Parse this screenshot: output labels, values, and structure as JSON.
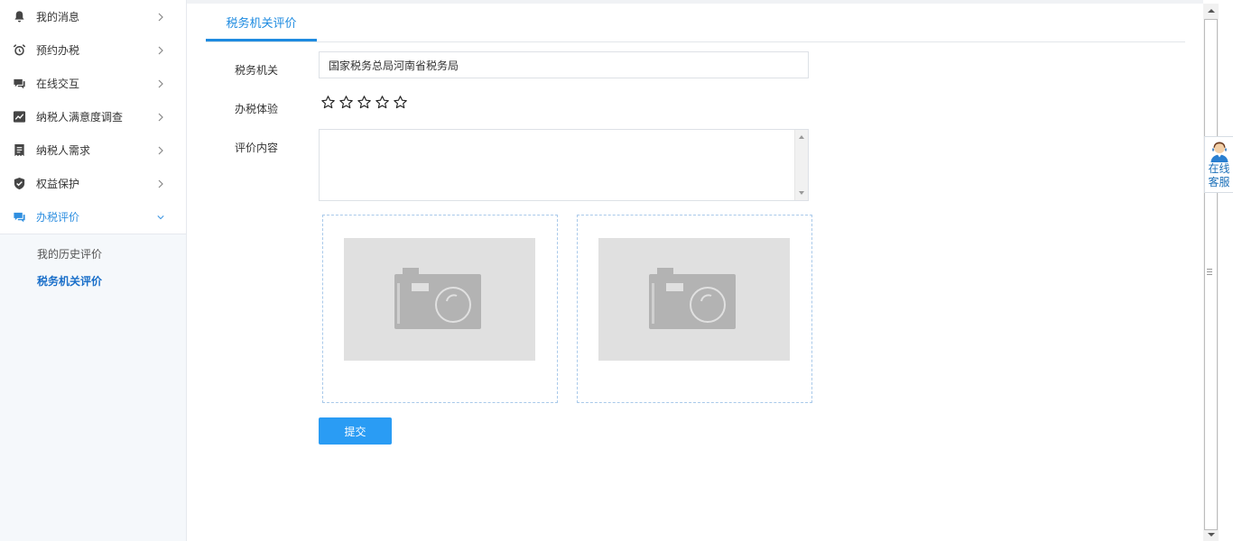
{
  "sidebar": {
    "items": [
      {
        "label": "我的消息",
        "icon": "bell-icon"
      },
      {
        "label": "预约办税",
        "icon": "alarm-clock-icon"
      },
      {
        "label": "在线交互",
        "icon": "chat-icon"
      },
      {
        "label": "纳税人满意度调查",
        "icon": "trend-chart-icon"
      },
      {
        "label": "纳税人需求",
        "icon": "document-icon"
      },
      {
        "label": "权益保护",
        "icon": "shield-check-icon"
      },
      {
        "label": "办税评价",
        "icon": "comment-icon"
      }
    ],
    "sub_items": [
      "我的历史评价",
      "税务机关评价"
    ]
  },
  "tab": {
    "label": "税务机关评价"
  },
  "form": {
    "authority_label": "税务机关",
    "authority_value": "国家税务总局河南省税务局",
    "experience_label": "办税体验",
    "rating": {
      "value": 0,
      "max": 5,
      "icon": "star-outline-icon"
    },
    "content_label": "评价内容",
    "content_value": "",
    "uploads": [
      {
        "icon": "camera-icon"
      },
      {
        "icon": "camera-icon"
      }
    ],
    "submit_label": "提交"
  },
  "service": {
    "line1": "在线",
    "line2": "客服",
    "icon": "customer-service-avatar-icon"
  },
  "colors": {
    "accent": "#1e8be0",
    "button": "#2a9cf4",
    "sub_active": "#1a6fc9"
  }
}
